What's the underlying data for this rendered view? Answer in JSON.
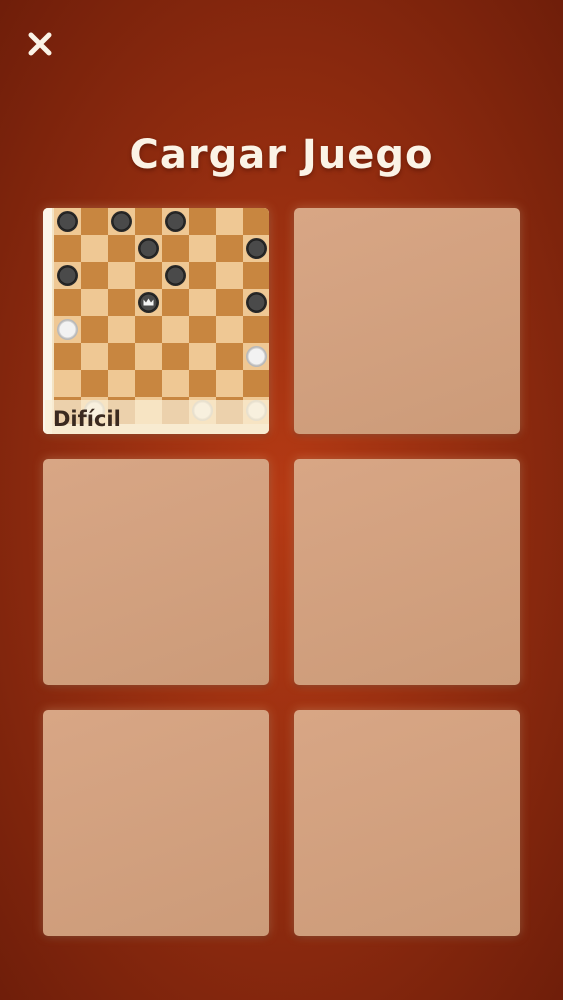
{
  "header": {
    "close_icon": "close-icon",
    "title": "Cargar Juego"
  },
  "colors": {
    "background": "#a33412",
    "slot_empty": "#d2a07e",
    "board_dark": "#c88640",
    "board_light": "#efc894",
    "piece_black": "#4a4a4a",
    "piece_white": "#f2f2f2"
  },
  "slots": [
    {
      "state": "saved",
      "difficulty": "Difícil",
      "board_size": 8,
      "pieces": [
        {
          "row": 0,
          "col": 0,
          "color": "black",
          "king": false
        },
        {
          "row": 0,
          "col": 2,
          "color": "black",
          "king": false
        },
        {
          "row": 0,
          "col": 4,
          "color": "black",
          "king": false
        },
        {
          "row": 1,
          "col": 3,
          "color": "black",
          "king": false
        },
        {
          "row": 1,
          "col": 7,
          "color": "black",
          "king": false
        },
        {
          "row": 2,
          "col": 0,
          "color": "black",
          "king": false
        },
        {
          "row": 2,
          "col": 4,
          "color": "black",
          "king": false
        },
        {
          "row": 3,
          "col": 3,
          "color": "black",
          "king": true
        },
        {
          "row": 3,
          "col": 7,
          "color": "black",
          "king": false
        },
        {
          "row": 4,
          "col": 0,
          "color": "white",
          "king": false
        },
        {
          "row": 5,
          "col": 7,
          "color": "white",
          "king": false
        },
        {
          "row": 7,
          "col": 1,
          "color": "white",
          "king": false
        },
        {
          "row": 7,
          "col": 5,
          "color": "white",
          "king": false
        },
        {
          "row": 7,
          "col": 7,
          "color": "white",
          "king": false
        }
      ]
    },
    {
      "state": "empty"
    },
    {
      "state": "empty"
    },
    {
      "state": "empty"
    },
    {
      "state": "empty"
    },
    {
      "state": "empty"
    }
  ]
}
